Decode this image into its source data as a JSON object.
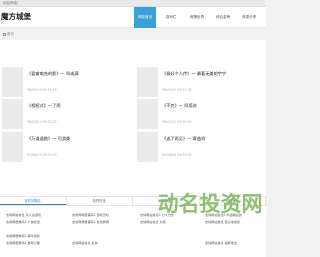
{
  "topbar": {
    "text": "欢迎来临！"
  },
  "header": {
    "logo": "魔方城堡",
    "nav": [
      "网站首页",
      "游戏栏",
      "竞猜世界",
      "综合金榜",
      "资源分享",
      "全部日志"
    ]
  },
  "breadcrumb": {
    "text": "首页"
  },
  "articles": [
    {
      "title": "《爱睿电充的影》一 叫或满",
      "meta": "06/05/03 09:32:56"
    },
    {
      "title": "《极好个人传》一 最著无美的宇宁",
      "meta": "06/05/03 09:27:02"
    },
    {
      "title": "《相权式》一了两",
      "meta": "06/03/01 09:32:02"
    },
    {
      "title": "《不克》一 阿塔苏",
      "meta": "06/03/01 09:50:00"
    },
    {
      "title": "《万道道路》一 司游美",
      "meta": "05/08/03 09:53:00"
    },
    {
      "title": "《送了再见》一 青曲鸿",
      "meta": "05/08/04 09:53:07"
    }
  ],
  "bottom_tabs": [
    "农村问题达",
    "情样时全",
    "五星侵",
    "三国演义"
  ],
  "bottom_links": [
    "友情网站信息 双人说游戏",
    "友情同网居事码2 游戏无标",
    "友情网站信息0 力义方式",
    "友情网站信息0 科通前后的",
    "友情网居推码2 人信标加",
    "友情同网居事码2 友情同网",
    "友情网站信息 对规",
    "友情网站信息 自清地成就",
    "友情网居推码2 解牛游标",
    "友情网居推码2 游戏引擎",
    "友情网站信息 名信",
    "友情网站信息 相样地合"
  ],
  "watermark": {
    "text": "动名投资网",
    "color": "#7ab55c"
  },
  "colors": {
    "accent": "#3aa0d8"
  }
}
